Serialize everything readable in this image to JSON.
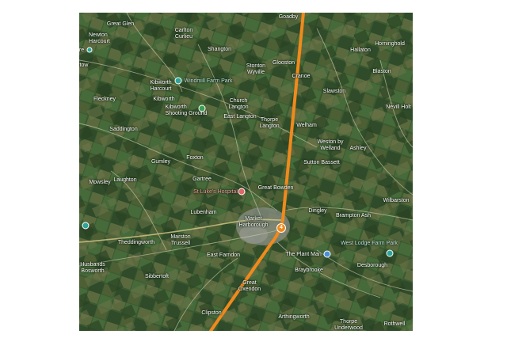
{
  "map": {
    "place_labels": [
      {
        "id": "goadby",
        "text": "Goadby"
      },
      {
        "id": "great-glen",
        "text": "Great Glen"
      },
      {
        "id": "newton-harcourt",
        "text": "Newton\nHarcourt"
      },
      {
        "id": "carlton-curlieu",
        "text": "Carlton\nCurlieu"
      },
      {
        "id": "horninghold",
        "text": "Horninghold"
      },
      {
        "id": "hallaton",
        "text": "Hallaton"
      },
      {
        "id": "shangton",
        "text": "Shangton"
      },
      {
        "id": "glooston",
        "text": "Glooston"
      },
      {
        "id": "stonton-wyville",
        "text": "Stonton\nWyville"
      },
      {
        "id": "cranoe",
        "text": "Cranoe"
      },
      {
        "id": "blaston",
        "text": "Blaston"
      },
      {
        "id": "kibworth-harcourt",
        "text": "Kibworth\nHarcourt"
      },
      {
        "id": "fleckney",
        "text": "Fleckney"
      },
      {
        "id": "kibworth",
        "text": "Kibworth"
      },
      {
        "id": "slawston",
        "text": "Slawston"
      },
      {
        "id": "kibworth-shooting",
        "text": "Kibworth\nShooting Ground"
      },
      {
        "id": "church-langton",
        "text": "Church\nLangton"
      },
      {
        "id": "nevill-holt",
        "text": "Nevill Holt"
      },
      {
        "id": "saddington",
        "text": "Saddington"
      },
      {
        "id": "east-langton",
        "text": "East Langton"
      },
      {
        "id": "thorpe-langton",
        "text": "Thorpe\nLangton"
      },
      {
        "id": "welham",
        "text": "Welham"
      },
      {
        "id": "weston-by-welland",
        "text": "Weston by\nWelland"
      },
      {
        "id": "ashley",
        "text": "Ashley"
      },
      {
        "id": "gumley",
        "text": "Gumley"
      },
      {
        "id": "foxton",
        "text": "Foxton"
      },
      {
        "id": "sutton-bassett",
        "text": "Sutton Bassett"
      },
      {
        "id": "mowsley",
        "text": "Mowsley"
      },
      {
        "id": "laughton",
        "text": "Laughton"
      },
      {
        "id": "gartree",
        "text": "Gartree"
      },
      {
        "id": "great-bowden",
        "text": "Great Bowden"
      },
      {
        "id": "wilbarston",
        "text": "Wilbarston"
      },
      {
        "id": "lubenham",
        "text": "Lubenham"
      },
      {
        "id": "dingley",
        "text": "Dingley"
      },
      {
        "id": "brampton-ash",
        "text": "Brampton Ash"
      },
      {
        "id": "market-harborough",
        "text": "Market\nHarborough"
      },
      {
        "id": "theddingworth",
        "text": "Theddingworth"
      },
      {
        "id": "marston-trussell",
        "text": "Marston\nTrussell"
      },
      {
        "id": "husbands-bosworth",
        "text": "Husbands\nBosworth"
      },
      {
        "id": "east-farndon",
        "text": "East Farndon"
      },
      {
        "id": "braybrooke",
        "text": "Braybrooke"
      },
      {
        "id": "desborough",
        "text": "Desborough"
      },
      {
        "id": "great-oxendon",
        "text": "Great\nOxendon"
      },
      {
        "id": "sibbertoft",
        "text": "Sibbertoft"
      },
      {
        "id": "clipston",
        "text": "Clipston"
      },
      {
        "id": "arthingworth",
        "text": "Arthingworth"
      },
      {
        "id": "thorpe-underwood",
        "text": "Thorpe\nUnderwood"
      },
      {
        "id": "rothwell",
        "text": "Rothwell"
      },
      {
        "id": "partial-tow",
        "text": "tow"
      },
      {
        "id": "partial-re",
        "text": "re"
      }
    ],
    "poi_labels": [
      {
        "id": "windmill-farm-park",
        "text": "Windmill Farm Park",
        "icon": "attraction-icon",
        "color": "#2fa39a"
      },
      {
        "id": "st-lukes-hospital",
        "text": "St Luke's Hospital",
        "icon": "hospital-icon",
        "color": "#e06767"
      },
      {
        "id": "the-plant-man",
        "text": "The Plant Man",
        "icon": "shopping-bag-icon",
        "color": "#4a8fd6"
      },
      {
        "id": "west-lodge-farm-park",
        "text": "West Lodge Farm Park",
        "icon": "attraction-icon",
        "color": "#2fa39a"
      }
    ],
    "route": {
      "badge": "4",
      "color": "#f08a1c"
    }
  }
}
